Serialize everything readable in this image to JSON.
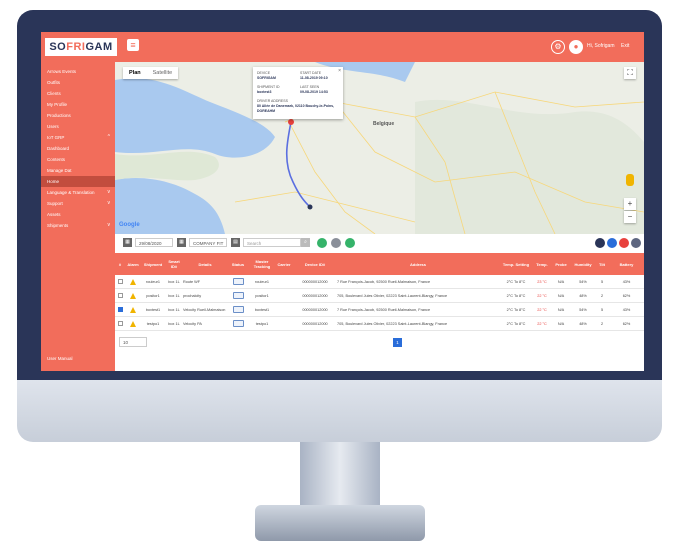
{
  "app": {
    "logo_left": "SO",
    "logo_mid": "FRI",
    "logo_right": "GAM",
    "user_name": "Hi, Sofrigam",
    "logout_label": "Exit"
  },
  "sidebar": {
    "items": [
      {
        "label": "Arrows Events"
      },
      {
        "label": "Outfits"
      },
      {
        "label": "Clients"
      },
      {
        "label": "My Profile"
      },
      {
        "label": "Productions"
      },
      {
        "label": "Users"
      },
      {
        "label": "IoT GRP",
        "caret": "^"
      },
      {
        "label": "Dashboard"
      },
      {
        "label": "Contents"
      },
      {
        "label": "Manage Dat"
      },
      {
        "label": "Home"
      },
      {
        "label": "Language & Translation",
        "caret": "v"
      },
      {
        "label": "Support",
        "caret": "v"
      },
      {
        "label": "Assets"
      },
      {
        "label": "Shipments",
        "caret": "v"
      }
    ],
    "footer_label": "User Manual"
  },
  "map": {
    "type_map": "Plan",
    "type_satellite": "Satellite",
    "city_label": "Belgique",
    "google": "Google",
    "popup": {
      "device_key": "DEVICE",
      "device_val": "SOFRIGAM",
      "start_key": "START DATE",
      "start_val": "11-08-2019 09:10",
      "shipment_key": "SHIPMENT ID",
      "shipment_val": "boxtest3",
      "last_key": "LAST SEEN",
      "last_val": "09-08-2019 14:53",
      "addr_key": "DRIVER ADDRESS",
      "addr_val": "80 Allée de Danemark, 02110 Bouchy-le-Poins, DOREAHM"
    }
  },
  "filters": {
    "date": "29/08/2020",
    "company": "COMPANY FIT",
    "search_placeholder": "Search"
  },
  "table": {
    "headers": [
      "#",
      "Alarm",
      "Shipment",
      "Smart ID#",
      "Details",
      "Status",
      "Master Tracking",
      "Carrier",
      "Device ID#",
      "Address",
      "Temp. Setting",
      "Temp.",
      "Probe",
      "Humidity",
      "Tilt",
      "Battery"
    ],
    "rows": [
      {
        "checked": false,
        "shipment": "rouleur1",
        "smart": "box 1L",
        "details": "Route WF",
        "master": "rouleur1",
        "device": "000000012000",
        "address": "7 Rue François-Jacob, 92500 Rueil-Malmaison, France",
        "tempset": "2°C To 8°C",
        "temp": "23 °C",
        "probe": "N/A",
        "humidity": "54%",
        "tilt": "5",
        "battery": "43%"
      },
      {
        "checked": false,
        "shipment": "positor1",
        "smart": "box 1L",
        "details": "prochalcity",
        "master": "positor1",
        "device": "000000012000",
        "address": "705, Boulevard Jules Olivier, 02223 Saint-Laurent-Blangy, France",
        "tempset": "2°C To 8°C",
        "temp": "22 °C",
        "probe": "N/A",
        "humidity": "48%",
        "tilt": "2",
        "battery": "62%"
      },
      {
        "checked": true,
        "shipment": "boxtest1",
        "smart": "box 1L",
        "details": "Velocity Rueil-Malmaison",
        "master": "boxtest1",
        "device": "000000012000",
        "address": "7 Rue François-Jacob, 92500 Rueil-Malmaison, France",
        "tempset": "2°C To 8°C",
        "temp": "22 °C",
        "probe": "N/A",
        "humidity": "54%",
        "tilt": "5",
        "battery": "43%"
      },
      {
        "checked": false,
        "shipment": "testpo1",
        "smart": "box 1L",
        "details": "Velocity PA",
        "master": "testpo1",
        "device": "000000012000",
        "address": "705, Boulevard Jules Olivier, 02223 Saint-Laurent-Blangy, France",
        "tempset": "2°C To 8°C",
        "temp": "22 °C",
        "probe": "N/A",
        "humidity": "48%",
        "tilt": "2",
        "battery": "62%"
      }
    ]
  },
  "pager": {
    "size": "10",
    "page": "1"
  },
  "colors": {
    "brand": "#f26d5b",
    "dark": "#2a3558",
    "accent": "#2a6dd9",
    "alert": "#e8413d"
  }
}
